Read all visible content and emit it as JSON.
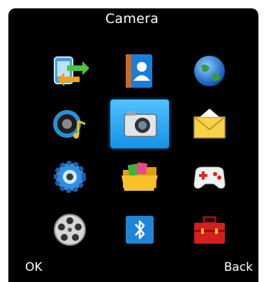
{
  "screen": {
    "title": "Camera",
    "selected_index": 4
  },
  "menu": [
    {
      "id": "phonebook-transfer",
      "icon": "contacts-transfer-icon"
    },
    {
      "id": "contacts",
      "icon": "address-book-icon"
    },
    {
      "id": "internet",
      "icon": "globe-icon"
    },
    {
      "id": "music",
      "icon": "speaker-music-icon"
    },
    {
      "id": "camera",
      "icon": "camera-icon"
    },
    {
      "id": "messages",
      "icon": "envelope-icon"
    },
    {
      "id": "settings",
      "icon": "gear-icon"
    },
    {
      "id": "files",
      "icon": "folder-icon"
    },
    {
      "id": "games",
      "icon": "gamepad-icon"
    },
    {
      "id": "video",
      "icon": "film-reel-icon"
    },
    {
      "id": "bluetooth",
      "icon": "bluetooth-icon"
    },
    {
      "id": "tools",
      "icon": "toolbox-icon"
    }
  ],
  "softkeys": {
    "left": "OK",
    "right": "Back"
  },
  "colors": {
    "background": "#000000",
    "highlight": "#2aa5f2",
    "text": "#ffffff"
  }
}
